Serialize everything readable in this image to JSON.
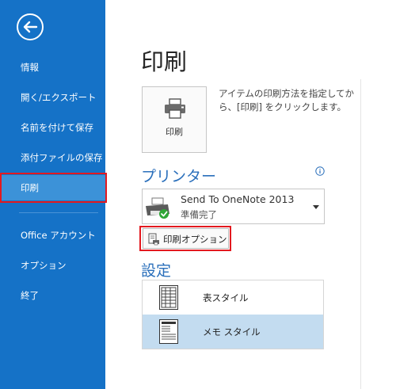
{
  "sidebar": {
    "items": [
      {
        "label": "情報"
      },
      {
        "label": "開く/エクスポート"
      },
      {
        "label": "名前を付けて保存"
      },
      {
        "label": "添付ファイルの保存"
      },
      {
        "label": "印刷"
      },
      {
        "label": "Office アカウント"
      },
      {
        "label": "オプション"
      },
      {
        "label": "終了"
      }
    ],
    "active_index": 4,
    "bg_color": "#1572c7"
  },
  "main": {
    "title": "印刷",
    "print_button": {
      "label": "印刷"
    },
    "description": "アイテムの印刷方法を指定してから、[印刷] をクリックします。",
    "printer_section": {
      "title": "プリンター",
      "selected_printer": {
        "name": "Send To OneNote 2013",
        "status": "準備完了"
      },
      "print_options_label": "印刷オプション"
    },
    "settings_section": {
      "title": "設定",
      "styles": [
        {
          "label": "表スタイル",
          "selected": false
        },
        {
          "label": "メモ スタイル",
          "selected": true
        }
      ]
    }
  },
  "colors": {
    "accent": "#2a6fbb",
    "highlight_red": "#e3191f",
    "selected_row": "#c3dcf0"
  }
}
